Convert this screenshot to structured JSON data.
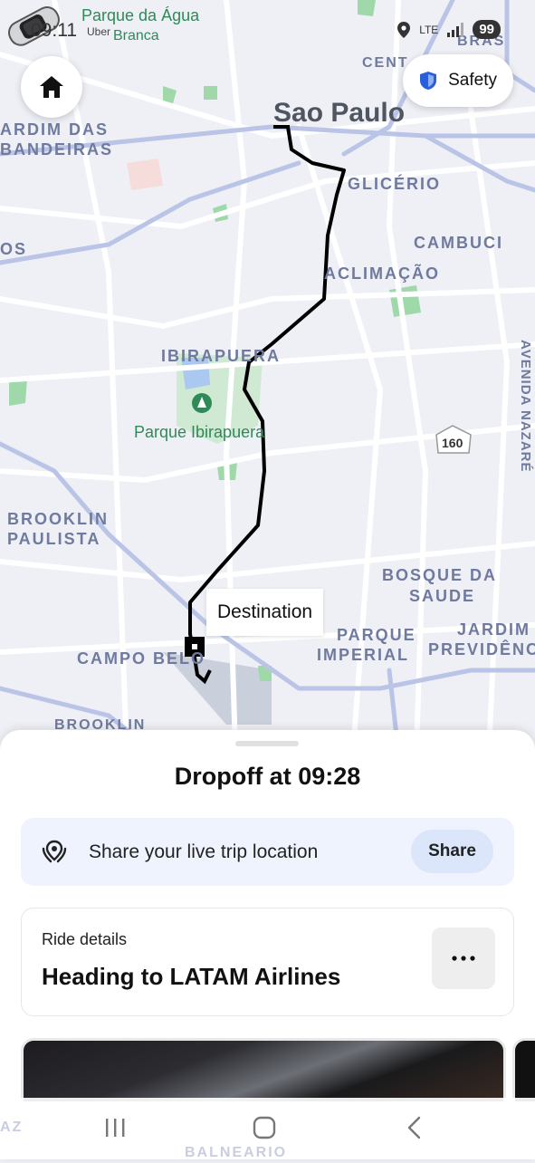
{
  "status_bar": {
    "time": "09:11",
    "app": "Uber",
    "network": "LTE",
    "battery": "99"
  },
  "map": {
    "city": "Sao Paulo",
    "labels": {
      "parque_da_agua": "Parque da Água",
      "branca": "Branca",
      "cent": "CENT",
      "bras": "BRAS",
      "jardim_das_bandeiras_1": "ARDIM DAS",
      "jardim_das_bandeiras_2": "BANDEIRAS",
      "glicerio": "GLICÉRIO",
      "os": "OS",
      "cambuci": "CAMBUCI",
      "aclimacao": "ACLIMAÇÃO",
      "ibirapuera": "IBIRAPUERA",
      "parque_ibirapuera": "Parque Ibirapuera",
      "avenida_nazare": "AVENIDA NAZARÉ",
      "route_160": "160",
      "brooklin_paulista_1": "BROOKLIN",
      "brooklin_paulista_2": "PAULISTA",
      "bosque_da_saude_1": "BOSQUE DA",
      "bosque_da_saude_2": "SAUDE",
      "parque_imperial_1": "PARQUE",
      "parque_imperial_2": "IMPERIAL",
      "jardim_previdencia_1": "JARDIM",
      "jardim_previdencia_2": "PREVIDÊNC",
      "campo_belo": "CAMPO BELO",
      "brooklin": "BROOKLIN"
    }
  },
  "controls": {
    "home_icon": "home-icon",
    "safety_label": "Safety",
    "safety_icon": "shield-icon",
    "destination_label": "Destination"
  },
  "colors": {
    "route": "#000000",
    "map_bg": "#eef0f6",
    "water": "#aac8f0",
    "park": "#9fd8a9",
    "share_card": "#eef3fd",
    "share_button": "#dce6fb"
  },
  "sheet": {
    "dropoff_text": "Dropoff at 09:28",
    "share": {
      "text": "Share your live trip location",
      "button": "Share",
      "icon": "location-share-icon"
    },
    "ride": {
      "label": "Ride details",
      "title": "Heading to LATAM Airlines",
      "more_icon": "more-options-icon"
    }
  },
  "nav": {
    "recents_icon": "recents-icon",
    "home_icon": "home-nav-icon",
    "back_icon": "back-icon",
    "behind_label_1": "AZ",
    "behind_label_2": "BALNEARIO"
  }
}
